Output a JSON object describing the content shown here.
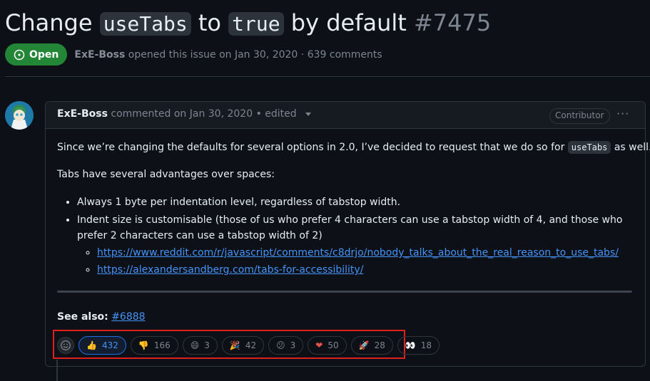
{
  "issue": {
    "title_part1": "Change",
    "title_code1": "useTabs",
    "title_part2": "to",
    "title_code2": "true",
    "title_part3": "by default",
    "number": "#7475",
    "state": "Open",
    "author": "ExE-Boss",
    "opened_text": "opened this issue on Jan 30, 2020 · 639 comments"
  },
  "comment": {
    "author": "ExE-Boss",
    "meta": "commented on Jan 30, 2020 • edited",
    "role": "Contributor",
    "more_label": "···",
    "para1_before": "Since we’re changing the defaults for several options in 2.0, I’ve decided to request that we do so for",
    "para1_code": "useTabs",
    "para1_after": "as well.",
    "para2": "Tabs have several advantages over spaces:",
    "bullets": [
      "Always 1 byte per indentation level, regardless of tabstop width.",
      "Indent size is customisable (those of us who prefer 4 characters can use a tabstop width of 4, and those who",
      "prefer 2 characters can use a tabstop width of 2)"
    ],
    "links": [
      "https://www.reddit.com/r/javascript/comments/c8drjo/nobody_talks_about_the_real_reason_to_use_tabs/",
      "https://alexandersandberg.com/tabs-for-accessibility/"
    ],
    "see_also_label": "See also:",
    "see_also_link": "#6888"
  },
  "reactions": [
    {
      "icon": "thumbs-up-icon",
      "emoji": "👍",
      "count": "432",
      "active": true
    },
    {
      "icon": "thumbs-down-icon",
      "emoji": "👎",
      "count": "166",
      "active": false
    },
    {
      "icon": "laugh-icon",
      "emoji": "😄",
      "count": "3",
      "active": false
    },
    {
      "icon": "hooray-icon",
      "emoji": "🎉",
      "count": "42",
      "active": false
    },
    {
      "icon": "confused-icon",
      "emoji": "😕",
      "count": "3",
      "active": false
    },
    {
      "icon": "heart-icon",
      "emoji": "❤",
      "count": "50",
      "active": false
    },
    {
      "icon": "rocket-icon",
      "emoji": "🚀",
      "count": "28",
      "active": false
    },
    {
      "icon": "eyes-icon",
      "emoji": "👀",
      "count": "18",
      "active": false
    }
  ],
  "colors": {
    "background": "#0d1117",
    "open_green": "#238636",
    "link_blue": "#4493f8",
    "highlight_red": "#e0201c"
  }
}
